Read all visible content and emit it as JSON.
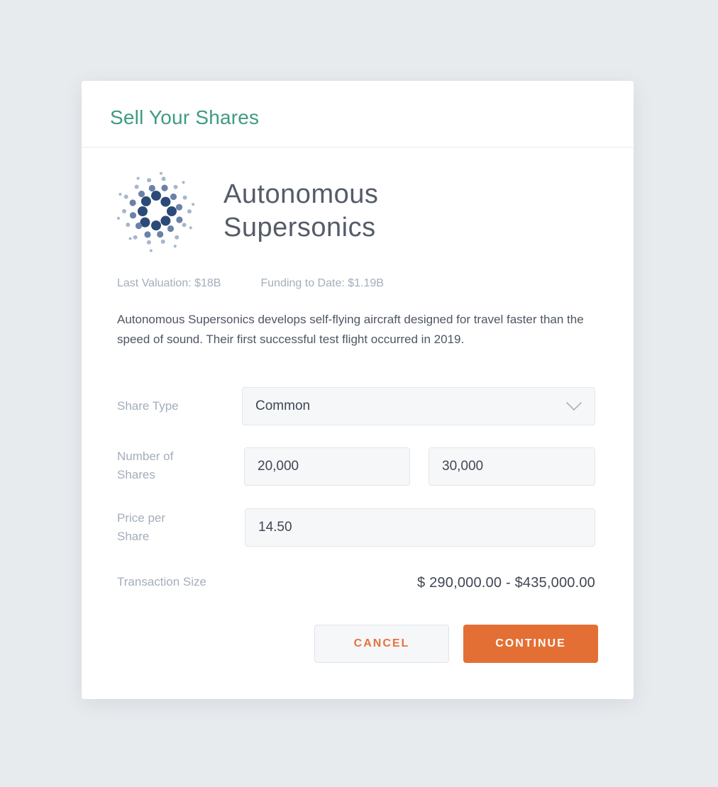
{
  "modal": {
    "title": "Sell Your Shares"
  },
  "company": {
    "logo_icon": "dot-cluster-logo",
    "name_line1": "Autonomous",
    "name_line2": "Supersonics",
    "last_valuation": "Last Valuation: $18B",
    "funding_to_date": "Funding to Date: $1.19B",
    "description": "Autonomous Supersonics develops self-flying aircraft designed for travel faster than the speed of sound. Their first successful test flight occurred in 2019."
  },
  "form": {
    "share_type_label": "Share Type",
    "share_type_value": "Common",
    "num_shares_label_line1": "Number of",
    "num_shares_label_line2": "Shares",
    "num_shares_min": "20,000",
    "num_shares_max": "30,000",
    "price_label_line1": "Price per",
    "price_label_line2": "Share",
    "price_value": "14.50",
    "transaction_label": "Transaction Size",
    "transaction_value": "$ 290,000.00 - $435,000.00"
  },
  "actions": {
    "cancel_label": "CANCEL",
    "continue_label": "CONTINUE"
  },
  "colors": {
    "accent_green": "#3f9a84",
    "accent_orange": "#e46f34",
    "logo_dark": "#2c4a78",
    "logo_mid": "#6a82a8",
    "logo_light": "#a8b6cc"
  }
}
